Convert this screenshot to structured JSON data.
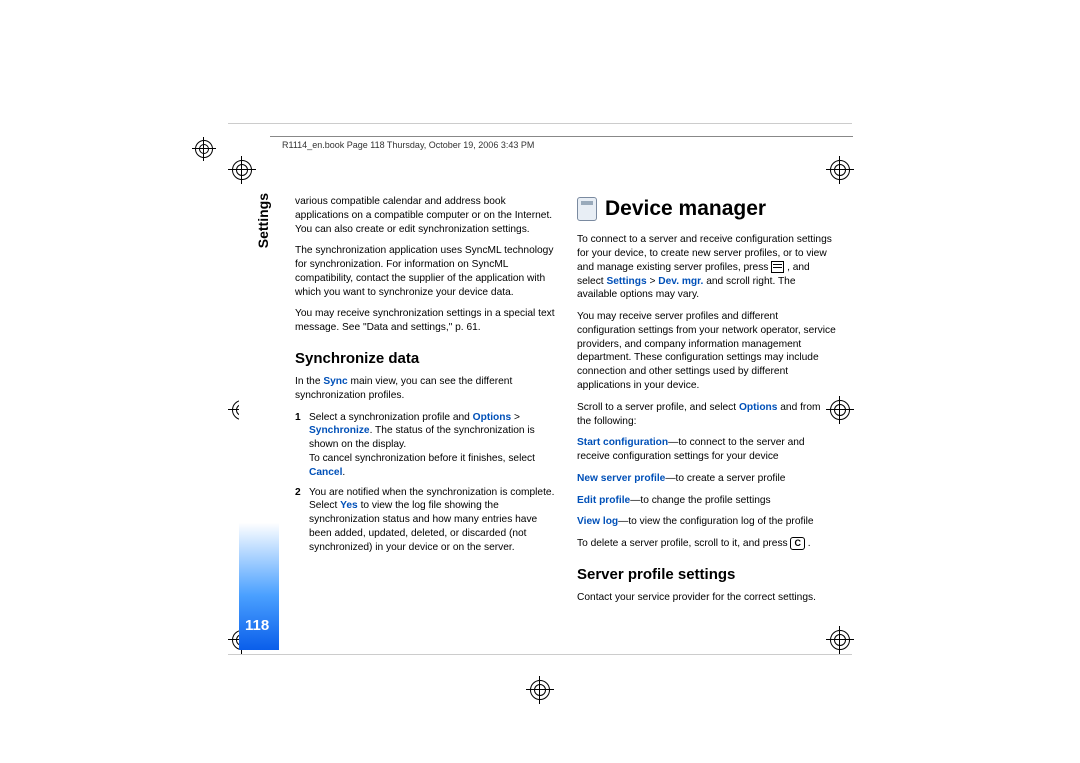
{
  "header": "R1114_en.book  Page 118  Thursday, October 19, 2006  3:43 PM",
  "sideTab": "Settings",
  "pageNumber": "118",
  "left": {
    "p1": "various compatible calendar and address book applications on a compatible computer or on the Internet. You can also create or edit synchronization settings.",
    "p2": "The synchronization application uses SyncML technology for synchronization. For information on SyncML compatibility, contact the supplier of the application with which you want to synchronize your device data.",
    "p3": "You may receive synchronization settings in a special text message. See \"Data and settings,\" p. 61.",
    "h2": "Synchronize data",
    "p4a": "In the ",
    "p4b": "Sync",
    "p4c": " main view, you can see the different synchronization profiles.",
    "s1a": "Select a synchronization profile and ",
    "s1b": "Options",
    "s1c": " > ",
    "s1d": "Synchronize",
    "s1e": ". The status of the synchronization is shown on the display.",
    "s1f": "To cancel synchronization before it finishes, select ",
    "s1g": "Cancel",
    "s1h": ".",
    "s2a": "You are notified when the synchronization is complete. Select ",
    "s2b": "Yes",
    "s2c": " to view the log file showing the synchronization status and how many entries have been added, updated, deleted, or discarded (not synchronized) in your device or on the server."
  },
  "right": {
    "h1": "Device manager",
    "p1a": "To connect to a server and receive configuration settings for your device, to create new server profiles, or to view and manage existing server profiles, press ",
    "p1b": " , and select ",
    "p1c": "Settings",
    "p1d": " > ",
    "p1e": "Dev. mgr.",
    "p1f": " and scroll right. The available options may vary.",
    "p2": "You may receive server profiles and different configuration settings from your network operator, service providers, and company information management department. These configuration settings may include connection and other settings used by different applications in your device.",
    "p3a": "Scroll to a server profile, and select ",
    "p3b": "Options",
    "p3c": " and from the following:",
    "o1a": "Start configuration",
    "o1b": "—to connect to the server and receive configuration settings for your device",
    "o2a": "New server profile",
    "o2b": "—to create a server profile",
    "o3a": "Edit profile",
    "o3b": "—to change the profile settings",
    "o4a": "View log",
    "o4b": "—to view the configuration log of the profile",
    "p4a": "To delete a server profile, scroll to it, and press ",
    "p4b": " .",
    "h2": "Server profile settings",
    "p5": "Contact your service provider for the correct settings."
  },
  "keyC": "C"
}
